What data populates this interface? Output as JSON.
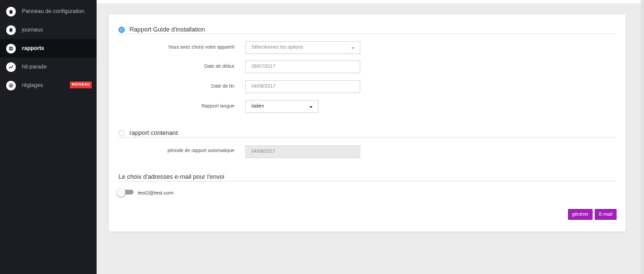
{
  "sidebar": {
    "items": [
      {
        "label": "Panneau de configuration",
        "icon": "home-icon"
      },
      {
        "label": "journaux",
        "icon": "bell-icon"
      },
      {
        "label": "rapports",
        "icon": "report-icon",
        "active": true
      },
      {
        "label": "hit-parade",
        "icon": "trend-icon"
      },
      {
        "label": "réglages",
        "icon": "gear-icon",
        "badge": "NOUVEAU"
      }
    ]
  },
  "report": {
    "title": "Rapport Guide d'installation",
    "device_label": "Vous avez choisi votre appareil",
    "device_placeholder": "Sélectionnez les options",
    "start_label": "Date de début",
    "start_value": "28/07/2017",
    "end_label": "Date de fin",
    "end_value": "04/08/2017",
    "lang_label": "Rapport langue",
    "lang_value": "italien"
  },
  "auto_report": {
    "title": "rapport contenant",
    "period_label": "période de rapport automatique",
    "period_value": "04/08/2017"
  },
  "email": {
    "title": "Le choix d'adresses e-mail pour l'envoi",
    "address": "test2@test.com"
  },
  "actions": {
    "generate": "générer",
    "email": "E-mail"
  },
  "colors": {
    "accent": "#a020b8",
    "radio_active": "#2196f3",
    "badge": "#e53935",
    "sidebar": "#1c1d23"
  }
}
